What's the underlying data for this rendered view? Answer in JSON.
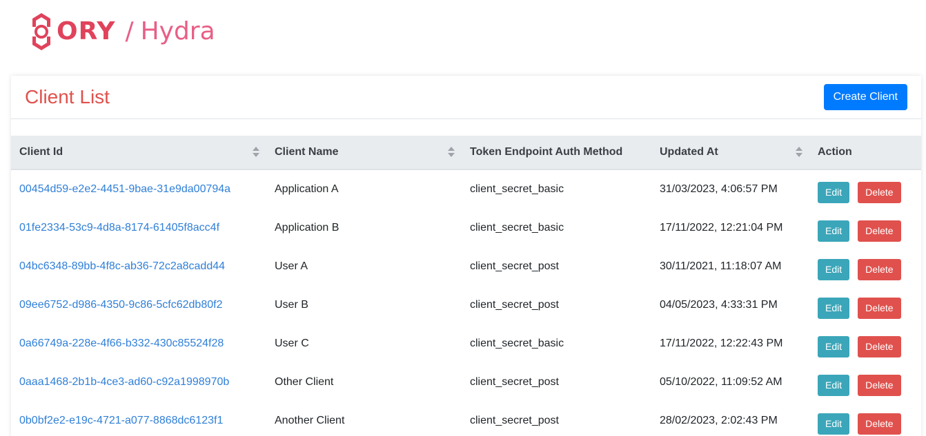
{
  "logo": {
    "brand": "ORY",
    "separator": "/",
    "product": "Hydra"
  },
  "card": {
    "title": "Client List",
    "create_button": "Create Client"
  },
  "table": {
    "columns": [
      {
        "label": "Client Id",
        "sortable": true
      },
      {
        "label": "Client Name",
        "sortable": true
      },
      {
        "label": "Token Endpoint Auth Method",
        "sortable": false
      },
      {
        "label": "Updated At",
        "sortable": true
      },
      {
        "label": "Action",
        "sortable": false
      }
    ],
    "rows": [
      {
        "id": "00454d59-e2e2-4451-9bae-31e9da00794a",
        "name": "Application A",
        "auth": "client_secret_basic",
        "updated": "31/03/2023, 4:06:57 PM",
        "edit": "Edit",
        "delete": "Delete"
      },
      {
        "id": "01fe2334-53c9-4d8a-8174-61405f8acc4f",
        "name": "Application B",
        "auth": "client_secret_basic",
        "updated": "17/11/2022, 12:21:04 PM",
        "edit": "Edit",
        "delete": "Delete"
      },
      {
        "id": "04bc6348-89bb-4f8c-ab36-72c2a8cadd44",
        "name": "User A",
        "auth": "client_secret_post",
        "updated": "30/11/2021, 11:18:07 AM",
        "edit": "Edit",
        "delete": "Delete"
      },
      {
        "id": "09ee6752-d986-4350-9c86-5cfc62db80f2",
        "name": "User B",
        "auth": "client_secret_post",
        "updated": "04/05/2023, 4:33:31 PM",
        "edit": "Edit",
        "delete": "Delete"
      },
      {
        "id": "0a66749a-228e-4f66-b332-430c85524f28",
        "name": "User C",
        "auth": "client_secret_basic",
        "updated": "17/11/2022, 12:22:43 PM",
        "edit": "Edit",
        "delete": "Delete"
      },
      {
        "id": "0aaa1468-2b1b-4ce3-ad60-c92a1998970b",
        "name": "Other Client",
        "auth": "client_secret_post",
        "updated": "05/10/2022, 11:09:52 AM",
        "edit": "Edit",
        "delete": "Delete"
      },
      {
        "id": "0b0bf2e2-e19c-4721-a077-8868dc6123f1",
        "name": "Another Client",
        "auth": "client_secret_post",
        "updated": "28/02/2023, 2:02:43 PM",
        "edit": "Edit",
        "delete": "Delete"
      }
    ]
  },
  "colors": {
    "brand": "#e0435c",
    "product": "#e85f86",
    "title": "#e0514d",
    "primary": "#007bff",
    "info": "#3ba6b9",
    "danger": "#e0514d",
    "link": "#2f7fd8"
  }
}
